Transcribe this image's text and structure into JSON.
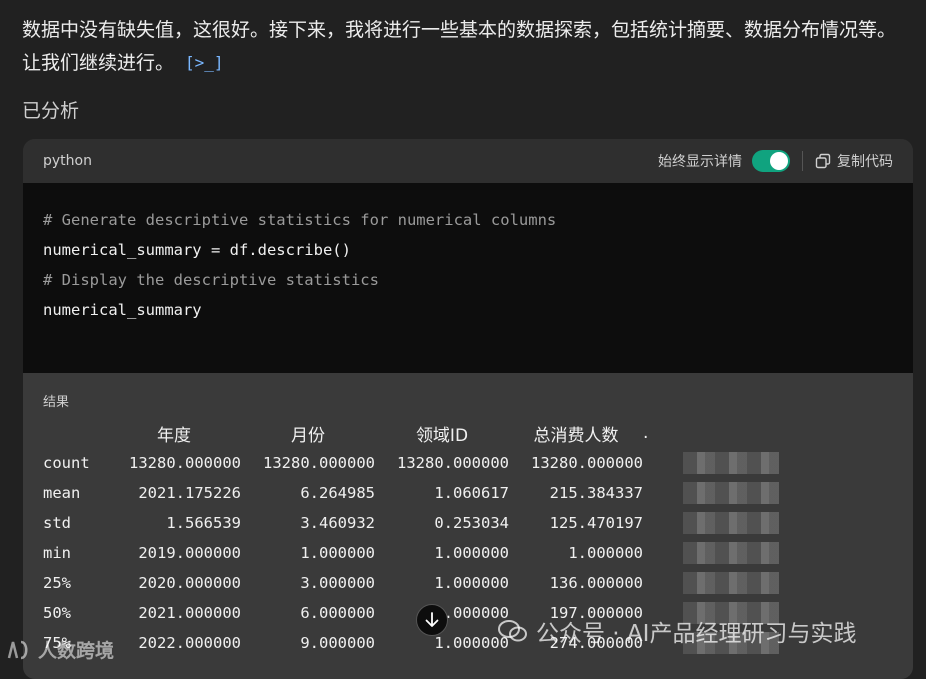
{
  "intro": {
    "text": "数据中没有缺失值，这很好。接下来，我将进行一些基本的数据探索，包括统计摘要、数据分布情况等。让我们继续进行。",
    "code_link_icon": "code-link-icon",
    "code_link_label": "[>_]"
  },
  "status": {
    "analyzed": "已分析"
  },
  "code_card": {
    "language": "python",
    "toggle_label": "始终显示详情",
    "toggle_on": true,
    "copy_label": "复制代码",
    "lines": [
      {
        "text": "# Generate descriptive statistics for numerical columns",
        "comment": true
      },
      {
        "text": "numerical_summary = df.describe()",
        "comment": false
      },
      {
        "text": "",
        "comment": false
      },
      {
        "text": "# Display the descriptive statistics",
        "comment": true
      },
      {
        "text": "numerical_summary",
        "comment": false
      }
    ]
  },
  "result": {
    "label": "结果",
    "headers": [
      "",
      "年度",
      "月份",
      "领域ID",
      "总消费人数"
    ],
    "header_dot": ".",
    "rows": [
      {
        "idx": "count",
        "values": [
          "13280.000000",
          "13280.000000",
          "13280.000000",
          "13280.000000"
        ]
      },
      {
        "idx": "mean",
        "values": [
          "2021.175226",
          "6.264985",
          "1.060617",
          "215.384337"
        ]
      },
      {
        "idx": "std",
        "values": [
          "1.566539",
          "3.460932",
          "0.253034",
          "125.470197"
        ]
      },
      {
        "idx": "min",
        "values": [
          "2019.000000",
          "1.000000",
          "1.000000",
          "1.000000"
        ]
      },
      {
        "idx": "25%",
        "values": [
          "2020.000000",
          "3.000000",
          "1.000000",
          "136.000000"
        ]
      },
      {
        "idx": "50%",
        "values": [
          "2021.000000",
          "6.000000",
          "1.000000",
          "197.000000"
        ]
      },
      {
        "idx": "75%",
        "values": [
          "2022.000000",
          "9.000000",
          "1.000000",
          "274.000000"
        ]
      }
    ]
  },
  "overlay": {
    "scroll_down_icon": "arrow-down-icon",
    "watermark": "公众号 · AI产品经理研习与实践",
    "brand": "人数跨境"
  }
}
